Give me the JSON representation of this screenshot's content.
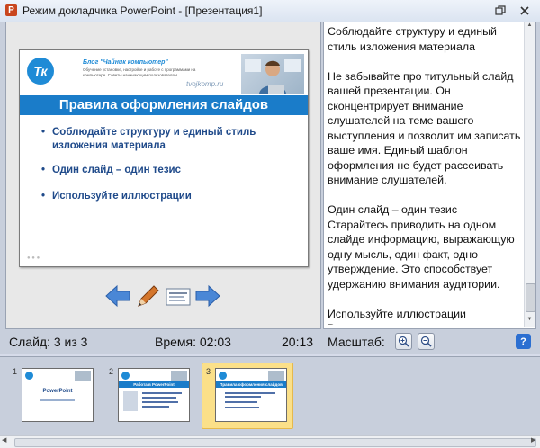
{
  "window": {
    "title": "Режим докладчика PowerPoint - [Презентация1]",
    "restore_icon": "restore-icon",
    "close_icon": "close-icon"
  },
  "slide": {
    "blog_name": "Блог \"Чайник компьютер\"",
    "blog_desc": "Обучение установке, настройке и работе с программами на компьютере. Советы начинающим пользователям",
    "site_url": "tvojkomp.ru",
    "logo_text": "Тк",
    "title": "Правила оформления слайдов",
    "bullets": [
      "Соблюдайте структуру и единый стиль изложения материала",
      "Один слайд – один тезис",
      "Используйте иллюстрации"
    ]
  },
  "notes": {
    "text": "Соблюдайте структуру и единый стиль изложения материала\n\nНе забывайте про титульный слайд вашей презентации. Он сконцентрирует внимание слушателей на теме вашего выступления и позволит им записать ваше имя. Единый шаблон оформления не будет рассеивать внимание слушателей.\n\nОдин слайд – один тезис\nСтарайтесь приводить на одном слайде информацию, выражающую одну мысль, один факт, одно утверждение. Это способствует удержанию внимания аудитории.\n\nИспользуйте иллюстрации\nВизуальное восприятие сильнее закрепляет в памяти информацию. Не зря же говорят: «Лучше один раз увидеть, чем сто раз услышать»"
  },
  "status": {
    "slide_counter": "Слайд: 3 из 3",
    "time": "Время: 02:03",
    "clock": "20:13",
    "zoom_label": "Масштаб:"
  },
  "thumbnails": [
    {
      "number": "1",
      "title": "PowerPoint",
      "selected": false
    },
    {
      "number": "2",
      "title": "Работа в PowerPoint",
      "selected": false
    },
    {
      "number": "3",
      "title": "Правила оформления слайдов",
      "selected": true
    }
  ],
  "colors": {
    "accent": "#1a7cc9",
    "bullet_text": "#1f4a8a",
    "selected_thumb": "#fbe089"
  }
}
